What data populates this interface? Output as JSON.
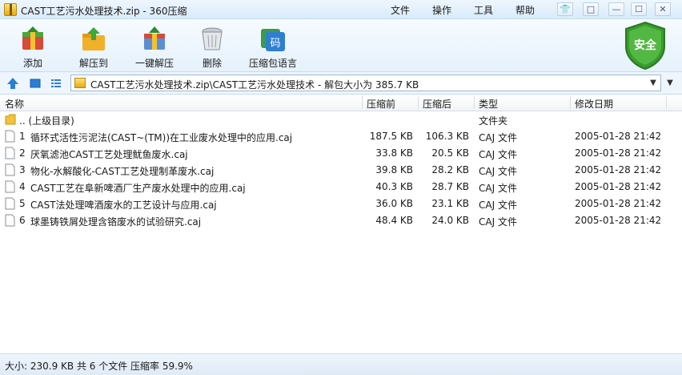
{
  "window": {
    "title": "CAST工艺污水处理技术.zip - 360压缩",
    "menus": [
      "文件",
      "操作",
      "工具",
      "帮助"
    ]
  },
  "toolbar": {
    "buttons": [
      {
        "label": "添加",
        "icon": "add-archive-icon"
      },
      {
        "label": "解压到",
        "icon": "extract-to-icon"
      },
      {
        "label": "一键解压",
        "icon": "one-click-extract-icon"
      },
      {
        "label": "删除",
        "icon": "delete-trash-icon"
      },
      {
        "label": "压缩包语言",
        "icon": "archive-language-icon"
      }
    ],
    "security_badge": "安全",
    "language_icon_text": "码"
  },
  "address": {
    "path": "CAST工艺污水处理技术.zip\\CAST工艺污水处理技术 - 解包大小为 385.7 KB"
  },
  "columns": [
    "名称",
    "压缩前",
    "压缩后",
    "类型",
    "修改日期"
  ],
  "parent_row": {
    "name": ".. (上级目录)",
    "type": "文件夹"
  },
  "files": [
    {
      "index": "1",
      "name": "循环式活性污泥法(CAST~(TM))在工业废水处理中的应用.caj",
      "before": "187.5 KB",
      "after": "106.3 KB",
      "type": "CAJ 文件",
      "modified": "2005-01-28 21:42"
    },
    {
      "index": "2",
      "name": "厌氧滤池CAST工艺处理鱿鱼废水.caj",
      "before": "33.8 KB",
      "after": "20.5 KB",
      "type": "CAJ 文件",
      "modified": "2005-01-28 21:42"
    },
    {
      "index": "3",
      "name": "物化-水解酸化-CAST工艺处理制革废水.caj",
      "before": "39.8 KB",
      "after": "28.2 KB",
      "type": "CAJ 文件",
      "modified": "2005-01-28 21:42"
    },
    {
      "index": "4",
      "name": "CAST工艺在阜新啤酒厂生产废水处理中的应用.caj",
      "before": "40.3 KB",
      "after": "28.7 KB",
      "type": "CAJ 文件",
      "modified": "2005-01-28 21:42"
    },
    {
      "index": "5",
      "name": "CAST法处理啤酒废水的工艺设计与应用.caj",
      "before": "36.0 KB",
      "after": "23.1 KB",
      "type": "CAJ 文件",
      "modified": "2005-01-28 21:42"
    },
    {
      "index": "6",
      "name": "球墨铸铁屑处理含铬废水的试验研究.caj",
      "before": "48.4 KB",
      "after": "24.0 KB",
      "type": "CAJ 文件",
      "modified": "2005-01-28 21:42"
    }
  ],
  "status": {
    "text": "大小: 230.9 KB 共 6 个文件 压缩率 59.9%"
  },
  "colors": {
    "accent": "#2a7fd4",
    "security_green": "#3a9b2e"
  }
}
